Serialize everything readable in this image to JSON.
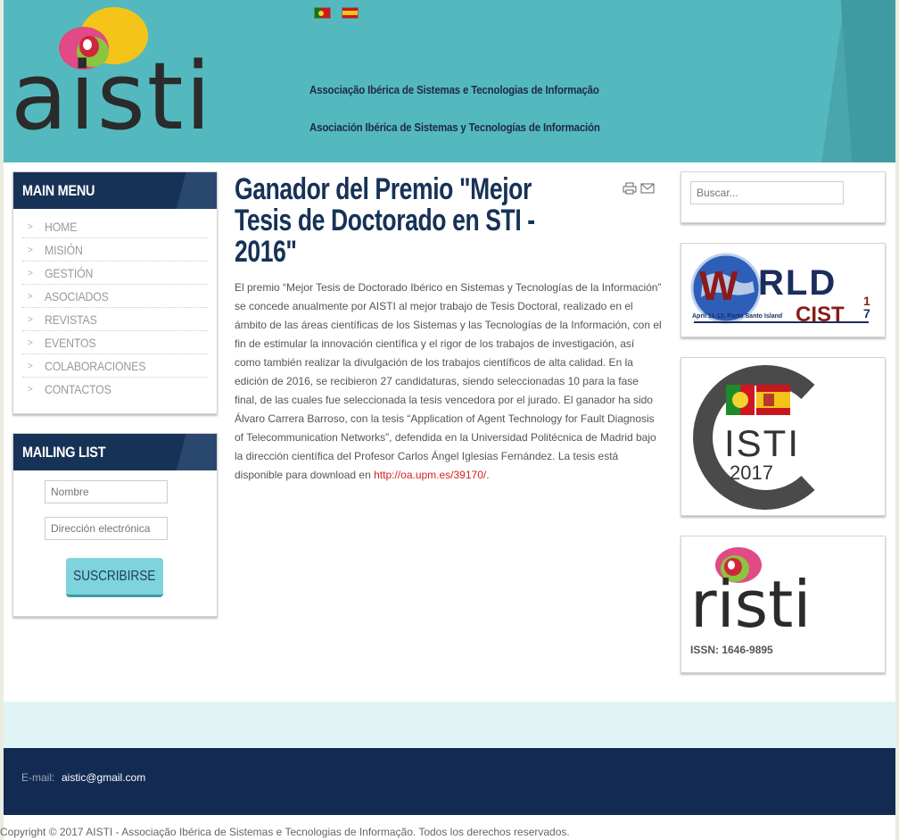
{
  "header": {
    "logo_text": "aisti",
    "org_name_pt": "Associação Ibérica de Sistemas e Tecnologias de Informação",
    "org_name_es": "Asociación Ibérica de Sistemas y Tecnologías de Información",
    "languages": [
      "pt-flag-icon",
      "es-flag-icon"
    ]
  },
  "main_menu": {
    "title": "MAIN MENU",
    "items": [
      {
        "label": "HOME"
      },
      {
        "label": "MISIÓN"
      },
      {
        "label": "GESTIÓN"
      },
      {
        "label": "ASOCIADOS"
      },
      {
        "label": "REVISTAS"
      },
      {
        "label": "EVENTOS"
      },
      {
        "label": "COLABORACIONES"
      },
      {
        "label": "CONTACTOS"
      }
    ]
  },
  "mailing_list": {
    "title": "MAILING LIST",
    "name_placeholder": "Nombre",
    "email_placeholder": "Dirección electrónica",
    "subscribe_label": "SUSCRIBIRSE"
  },
  "article": {
    "title": "Ganador del Premio \"Mejor Tesis de Doctorado en STI - 2016\"",
    "body": "El premio “Mejor Tesis de Doctorado Ibérico en Sistemas y Tecnologías de la Información” se concede anualmente por AISTI al mejor trabajo de Tesis Doctoral, realizado en el ámbito de las áreas científicas de los Sistemas y las Tecnologías de la Información, con el fin de estimular la innovación científica y el rigor de los trabajos de investigación, así como también realizar la divulgación de los trabajos científicos de alta calidad. En la edición de 2016, se recibieron 27 candidaturas, siendo seleccionadas 10 para la fase final, de las cuales fue seleccionada la tesis vencedora por el jurado. El ganador ha sido Álvaro Carrera Barroso, con la tesis “Application of Agent Technology for Fault Diagnosis of Telecommunication Networks”, defendida en la Universidad Politécnica de Madrid bajo la dirección científica del Profesor Carlos Ángel Iglesias Fernández. La tesis está disponible para download en ",
    "link_text": "http://oa.upm.es/39170/",
    "body_end": ".",
    "tools": [
      "print-icon",
      "email-icon"
    ]
  },
  "sidebar_right": {
    "search_placeholder": "Buscar...",
    "worldcist": {
      "word1": "W",
      "word2": "RLD",
      "word3": "CIST",
      "year_top": "1",
      "year_bottom": "7",
      "caption": "April 11-13, Porto Santo Island"
    },
    "cisti": {
      "name": "ISTI",
      "year": "2017"
    },
    "risti": {
      "name": "risti",
      "issn": "ISSN: 1646-9895"
    }
  },
  "footer": {
    "email_label": "E-mail:",
    "email_value": "aistic@gmail.com",
    "copyright": "Copyright © 2017 AISTI - Associação Ibérica de Sistemas e Tecnologias de Informação. Todos los derechos reservados."
  },
  "colors": {
    "header_bg": "#54b9be",
    "navy": "#173257",
    "footer_bg": "#132b52",
    "button_bg": "#7fd3dc",
    "link": "#d32222"
  }
}
